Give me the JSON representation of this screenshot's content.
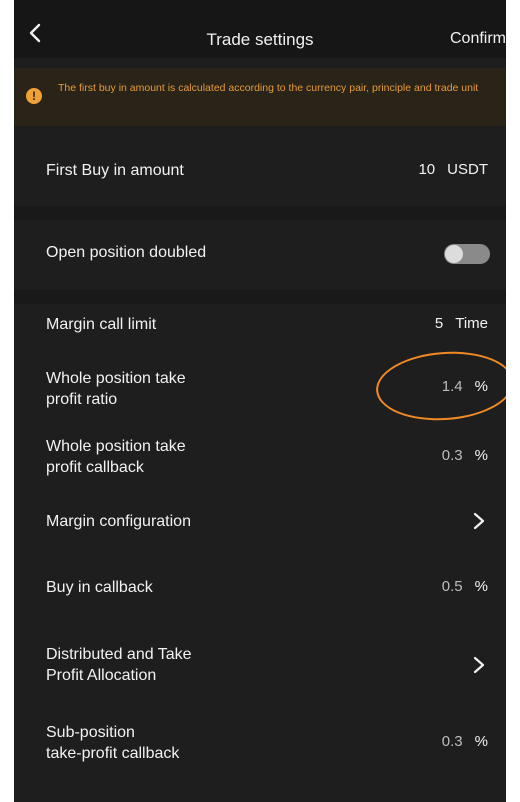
{
  "header": {
    "title": "Trade settings",
    "confirm_label": "Confirm"
  },
  "notice": {
    "icon": "exclamation-icon",
    "icon_glyph": "!",
    "text": "The first buy in amount is calculated according to the currency pair, principle and trade unit",
    "color": "#e59a3a"
  },
  "settings": {
    "first_buy": {
      "label": "First Buy in amount",
      "value": "10",
      "unit": "USDT"
    },
    "open_position_doubled": {
      "label": "Open position doubled",
      "enabled": false
    },
    "margin_call_limit": {
      "label": "Margin call limit",
      "value": "5",
      "unit": "Time"
    },
    "whole_tp_ratio": {
      "label_line1": "Whole position take",
      "label_line2": "profit ratio",
      "value": "1.4",
      "unit": "%"
    },
    "whole_tp_callback": {
      "label_line1": "Whole position take",
      "label_line2": "profit callback",
      "value": "0.3",
      "unit": "%"
    },
    "margin_configuration": {
      "label": "Margin configuration"
    },
    "buy_in_callback": {
      "label": "Buy in callback",
      "value": "0.5",
      "unit": "%"
    },
    "distributed_tp": {
      "label_line1": "Distributed and Take",
      "label_line2": "Profit Allocation"
    },
    "sub_position": {
      "label_line1": "Sub-position",
      "label_line2": "take-profit callback",
      "value": "0.3",
      "unit": "%"
    }
  },
  "colors": {
    "background": "#1e1e1e",
    "accent": "#f0a136",
    "annotation": "#f08a24"
  }
}
